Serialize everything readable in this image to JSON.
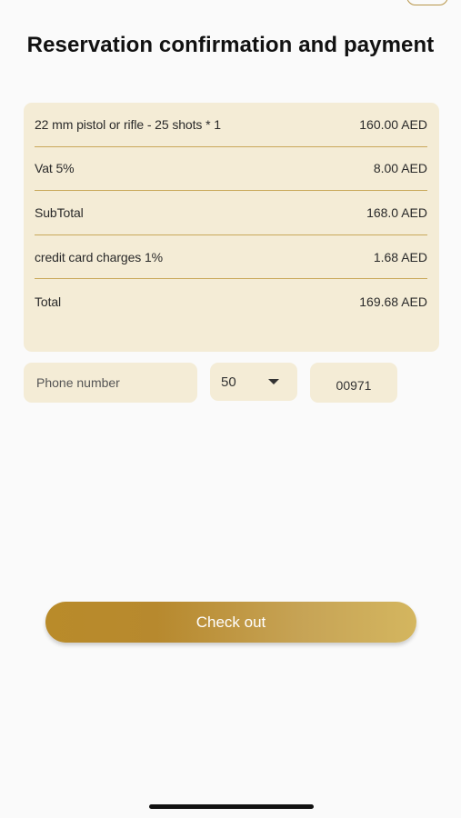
{
  "page": {
    "title": "Reservation confirmation and payment"
  },
  "summary": {
    "rows": [
      {
        "label": "22 mm pistol or rifle - 25 shots * 1",
        "value": "160.00 AED"
      },
      {
        "label": "Vat 5%",
        "value": "8.00 AED"
      },
      {
        "label": "SubTotal",
        "value": "168.0 AED"
      },
      {
        "label": "credit card charges 1%",
        "value": "1.68 AED"
      },
      {
        "label": "Total",
        "value": "169.68 AED"
      }
    ]
  },
  "phone": {
    "placeholder": "Phone number",
    "value": ""
  },
  "country_select": {
    "selected": "50"
  },
  "dial_code": {
    "value": "00971"
  },
  "checkout": {
    "label": "Check out"
  },
  "colors": {
    "background": "#fafafa",
    "card": "#f4ecd6",
    "divider": "#c9a85a",
    "button_gradient_start": "#b98b2a",
    "button_gradient_end": "#d4b65f"
  }
}
